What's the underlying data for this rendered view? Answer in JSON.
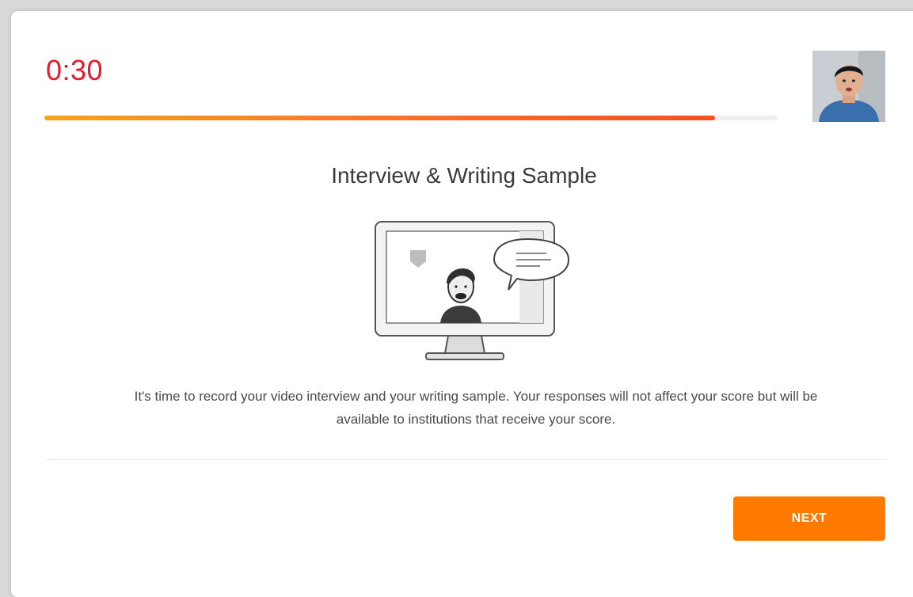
{
  "header": {
    "timer": "0:30",
    "progress_fraction": 0.915
  },
  "webcam": {
    "icon": "webcam-preview-person"
  },
  "main": {
    "title": "Interview & Writing Sample",
    "illustration": "computer-monitor-video-chat-icon",
    "description": "It's time to record your video interview and your writing sample. Your responses will not affect your score but will be available to institutions that receive your score."
  },
  "footer": {
    "next_label": "NEXT"
  },
  "colors": {
    "timer": "#e8192c",
    "accent": "#ff7a00",
    "progress_start": "#f7a21b",
    "progress_end": "#f4511e"
  }
}
